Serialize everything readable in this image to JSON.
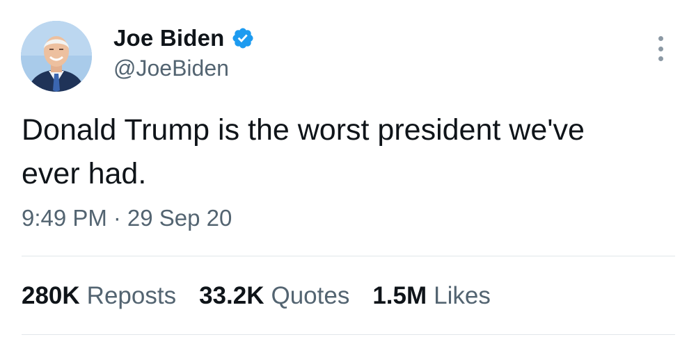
{
  "author": {
    "name": "Joe Biden",
    "handle": "@JoeBiden",
    "verified": true
  },
  "tweet": {
    "text": "Donald Trump is the worst president we've\never had.",
    "time": "9:49 PM",
    "separator": "·",
    "date": "29 Sep 20"
  },
  "stats": [
    {
      "count": "280K",
      "label": "Reposts"
    },
    {
      "count": "33.2K",
      "label": "Quotes"
    },
    {
      "count": "1.5M",
      "label": "Likes"
    }
  ],
  "colors": {
    "text_primary": "#0f1419",
    "text_secondary": "#536471",
    "verified_blue": "#1d9bf0",
    "divider": "#e1e6ea"
  },
  "icons": {
    "verified": "verified-badge-icon",
    "more": "more-options-icon"
  }
}
